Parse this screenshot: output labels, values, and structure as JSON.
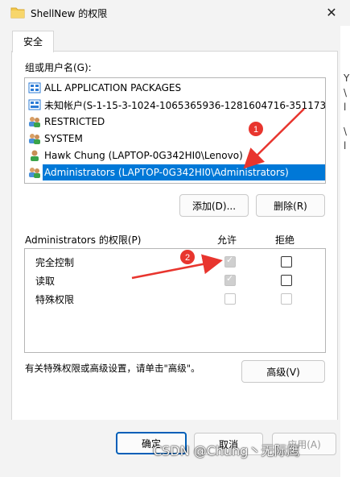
{
  "window": {
    "title": "ShellNew 的权限",
    "close_glyph": "✕"
  },
  "background_fragments": [
    "Y",
    "\\",
    "l",
    "\\",
    "l"
  ],
  "tab": {
    "label": "安全"
  },
  "groups": {
    "label": "组或用户名(G):",
    "items": [
      {
        "label": "ALL APPLICATION PACKAGES",
        "icon": "app-packages-icon"
      },
      {
        "label": "未知帐户(S-1-15-3-1024-1065365936-1281604716-351173...",
        "icon": "unknown-account-icon"
      },
      {
        "label": "RESTRICTED",
        "icon": "user-group-icon"
      },
      {
        "label": "SYSTEM",
        "icon": "user-group-icon"
      },
      {
        "label": "Hawk Chung (LAPTOP-0G342HI0\\Lenovo)",
        "icon": "user-icon"
      },
      {
        "label": "Administrators (LAPTOP-0G342HI0\\Administrators)",
        "icon": "user-group-icon",
        "selected": true
      }
    ]
  },
  "buttons": {
    "add": "添加(D)...",
    "remove": "删除(R)",
    "advanced": "高级(V)",
    "ok": "确定",
    "cancel": "取消",
    "apply": "应用(A)"
  },
  "permissions": {
    "label": "Administrators 的权限(P)",
    "allow_header": "允许",
    "deny_header": "拒绝",
    "rows": [
      {
        "name": "完全控制",
        "allow": true,
        "deny": false,
        "allow_enabled": false,
        "deny_enabled": true
      },
      {
        "name": "读取",
        "allow": true,
        "deny": false,
        "allow_enabled": false,
        "deny_enabled": true
      },
      {
        "name": "特殊权限",
        "allow": false,
        "deny": false,
        "allow_enabled": false,
        "deny_enabled": false
      }
    ]
  },
  "advanced_hint": "有关特殊权限或高级设置，请单击\"高级\"。",
  "annotations": {
    "marker1": "1",
    "marker2": "2",
    "color": "#e8352e"
  },
  "watermark": "CSDN @Chung丶无际鹰"
}
